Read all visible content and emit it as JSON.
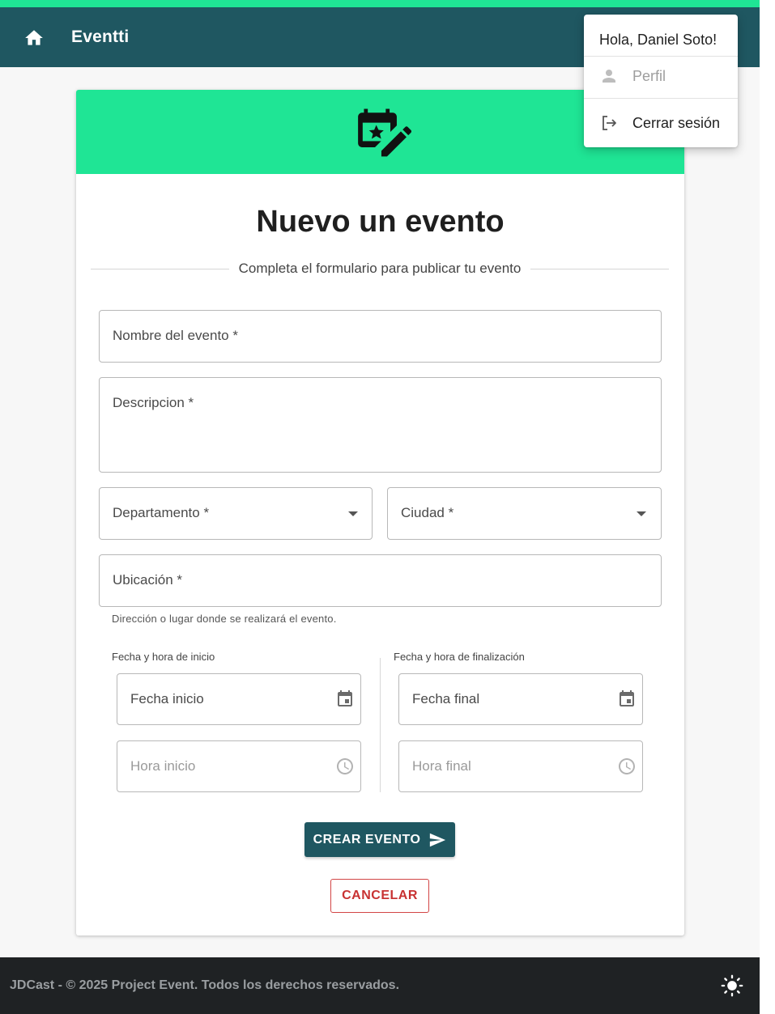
{
  "app": {
    "brand": "Eventti",
    "accent_color": "#1fe595",
    "primary_color": "#1f5761",
    "home_icon": "home-icon"
  },
  "user_menu": {
    "greeting": "Hola, Daniel Soto!",
    "items": [
      {
        "label": "Perfil",
        "icon": "person-icon",
        "disabled": true
      },
      {
        "label": "Cerrar sesión",
        "icon": "logout-icon",
        "disabled": false
      }
    ]
  },
  "form": {
    "header_icon": "calendar-edit-icon",
    "title": "Nuevo un evento",
    "subtitle": "Completa el formulario para publicar tu evento",
    "fields": {
      "name": {
        "label": "Nombre del evento *"
      },
      "description": {
        "label": "Descripcion *"
      },
      "department": {
        "label": "Departamento *"
      },
      "city": {
        "label": "Ciudad *"
      },
      "location": {
        "label": "Ubicación *",
        "hint": "Dirección o lugar donde se realizará el evento."
      }
    },
    "start_group": {
      "label": "Fecha y hora de inicio",
      "date": "Fecha inicio",
      "time": "Hora inicio"
    },
    "end_group": {
      "label": "Fecha y hora de finalización",
      "date": "Fecha final",
      "time": "Hora final"
    },
    "submit_label": "CREAR EVENTO",
    "cancel_label": "CANCELAR"
  },
  "footer": {
    "text": "JDCast - © 2025 Project Event. Todos los derechos reservados.",
    "theme_icon": "sun-icon"
  }
}
